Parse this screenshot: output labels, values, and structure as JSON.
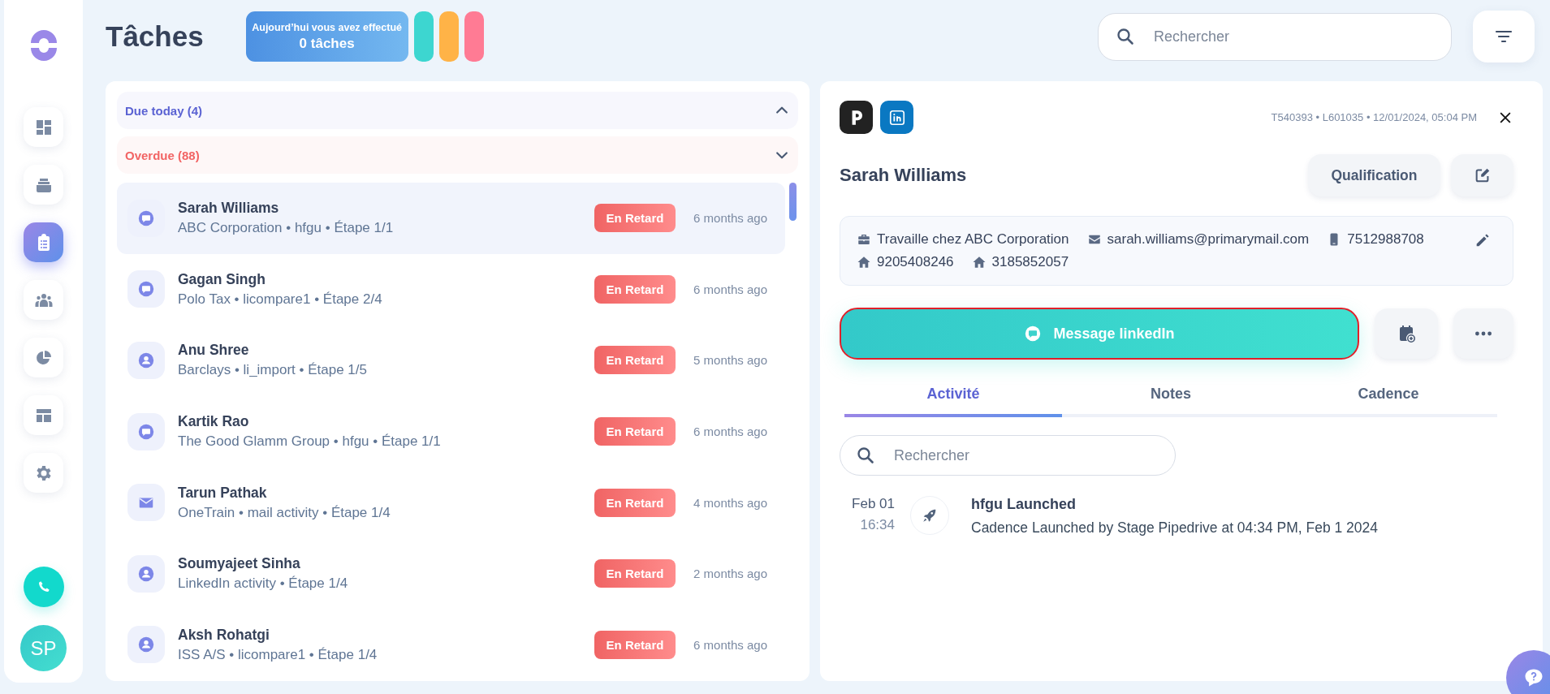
{
  "sidebar": {
    "nav": [
      {
        "kind": "dashboard",
        "selected": false
      },
      {
        "kind": "inbox",
        "selected": false
      },
      {
        "kind": "tasks",
        "selected": true
      },
      {
        "kind": "people",
        "selected": false
      },
      {
        "kind": "chart",
        "selected": false
      },
      {
        "kind": "layout",
        "selected": false
      },
      {
        "kind": "settings",
        "selected": false
      }
    ],
    "avatar": "SP"
  },
  "header": {
    "title": "Tâches",
    "stats": {
      "caption": "Aujourd’hui vous avez effectué",
      "value": "0 tâches"
    },
    "pills": [
      {
        "color": "#3dd6d0"
      },
      {
        "color": "#ffb347"
      },
      {
        "color": "#ff7b94"
      }
    ],
    "search": {
      "placeholder": "Rechercher"
    }
  },
  "sections": [
    {
      "label": "Due today (4)",
      "expanded": true,
      "color": "#5b63d3"
    },
    {
      "label": "Overdue (88)",
      "expanded": false,
      "color": "#f26464"
    }
  ],
  "tasks": [
    {
      "kind": "message",
      "name": "Sarah Williams",
      "details": "ABC Corporation • hfgu • Étape 1/1",
      "status": "En Retard",
      "time": "6 months ago",
      "selected": true
    },
    {
      "kind": "message",
      "name": "Gagan Singh",
      "details": "Polo Tax • licompare1 • Étape 2/4",
      "status": "En Retard",
      "time": "6 months ago",
      "selected": false
    },
    {
      "kind": "person",
      "name": "Anu Shree",
      "details": "Barclays • li_import • Étape 1/5",
      "status": "En Retard",
      "time": "5 months ago",
      "selected": false
    },
    {
      "kind": "message",
      "name": "Kartik Rao",
      "details": "The Good Glamm Group • hfgu • Étape 1/1",
      "status": "En Retard",
      "time": "6 months ago",
      "selected": false
    },
    {
      "kind": "mail",
      "name": "Tarun Pathak",
      "details": "OneTrain • mail activity • Étape 1/4",
      "status": "En Retard",
      "time": "4 months ago",
      "selected": false
    },
    {
      "kind": "person",
      "name": "Soumyajeet Sinha",
      "details": "LinkedIn activity • Étape 1/4",
      "status": "En Retard",
      "time": "2 months ago",
      "selected": false
    },
    {
      "kind": "person",
      "name": "Aksh Rohatgi",
      "details": "ISS A/S • licompare1 • Étape 1/4",
      "status": "En Retard",
      "time": "6 months ago",
      "selected": false
    }
  ],
  "detail": {
    "meta": "T540393 • L601035 • 12/01/2024, 05:04 PM",
    "name": "Sarah Williams",
    "qualification": "Qualification",
    "contact": [
      {
        "kind": "work",
        "text": "Travaille chez ABC Corporation"
      },
      {
        "kind": "email",
        "text": "sarah.williams@primarymail.com"
      },
      {
        "kind": "mobile",
        "text": "7512988708"
      },
      {
        "kind": "home",
        "text": "9205408246"
      },
      {
        "kind": "home",
        "text": "3185852057"
      }
    ],
    "action": "Message linkedIn",
    "tabs": [
      {
        "label": "Activité",
        "selected": true
      },
      {
        "label": "Notes",
        "selected": false
      },
      {
        "label": "Cadence",
        "selected": false
      }
    ],
    "search": {
      "placeholder": "Rechercher"
    },
    "activities": [
      {
        "date": "Feb 01",
        "time": "16:34",
        "title": "hfgu Launched",
        "description": "Cadence Launched by Stage Pipedrive at 04:34 PM, Feb 1 2024"
      }
    ]
  }
}
